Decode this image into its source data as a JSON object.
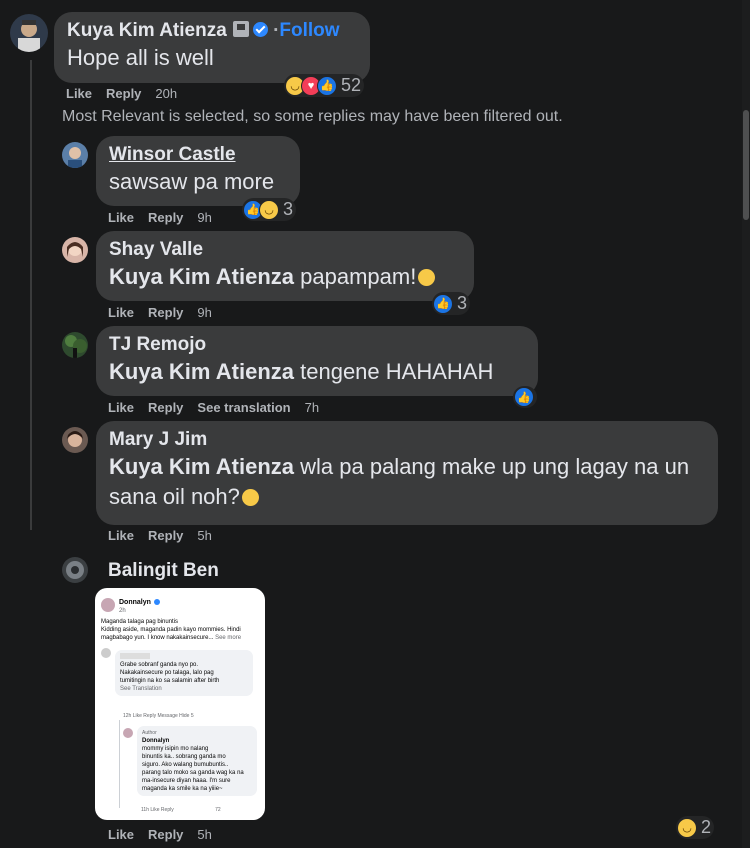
{
  "comments": [
    {
      "author": "Kuya Kim Atienza",
      "follow": "Follow",
      "text": "Hope all is well",
      "actions": {
        "like": "Like",
        "reply": "Reply",
        "time": "20h"
      },
      "reaction_count": "52",
      "reactions": [
        "haha-icon",
        "love-icon",
        "like-icon"
      ]
    }
  ],
  "filter_notice": "Most Relevant is selected, so some replies may have been filtered out.",
  "replies": [
    {
      "author": "Winsor Castle",
      "text": "sawsaw pa more",
      "like": "Like",
      "reply": "Reply",
      "time": "9h",
      "reaction_count": "3"
    },
    {
      "author": "Shay Valle",
      "mention": "Kuya Kim Atienza",
      "text": " papampam!",
      "like": "Like",
      "reply": "Reply",
      "time": "9h",
      "reaction_count": "3"
    },
    {
      "author": "TJ Remojo",
      "mention": "Kuya Kim Atienza",
      "text": " tengene HAHAHAH",
      "like": "Like",
      "reply": "Reply",
      "see_translation": "See translation",
      "time": "7h"
    },
    {
      "author": "Mary J Jim",
      "mention": "Kuya Kim Atienza",
      "text": " wla pa palang make up ung lagay na un sana oil noh?",
      "like": "Like",
      "reply": "Reply",
      "time": "5h"
    },
    {
      "author": "Balingit Ben",
      "like": "Like",
      "reply": "Reply",
      "time": "5h",
      "reaction_count": "2"
    }
  ],
  "attached_screenshot": {
    "post_author": "Donnalyn",
    "post_time": "2h",
    "post_line1": "Maganda talaga pag binuntis",
    "post_line2": "Kidding aside, maganda padin kayo mommies. Hindi",
    "post_line3": "magbabago yun. I know nakakainsecure...",
    "see_more": "See more",
    "comment_text1": "Grabe sobranf ganda nyo po.",
    "comment_text2": "Nakakainsecure po talaga, lalo pag",
    "comment_text3": "tumitingin na ko sa salamin after birth",
    "comment_meta": "12h  Like  Reply  Message  Hide",
    "comment_count": "5",
    "comment_translation": "See Translation",
    "author_badge": "Author",
    "reply_author": "Donnalyn",
    "reply_text1": "mommy isipin mo nalang",
    "reply_text2": "binuntis ka.. sobrang ganda mo",
    "reply_text3": "siguro. Ako walang bumubuntis..",
    "reply_text4": "parang talo moko sa ganda wag ka na",
    "reply_text5": "ma-insecure diyan haaa. I'm sure",
    "reply_text6": "maganda ka  smile ka na yiiie~",
    "reply_meta": "11h  Like  Reply",
    "reply_count": "72"
  }
}
